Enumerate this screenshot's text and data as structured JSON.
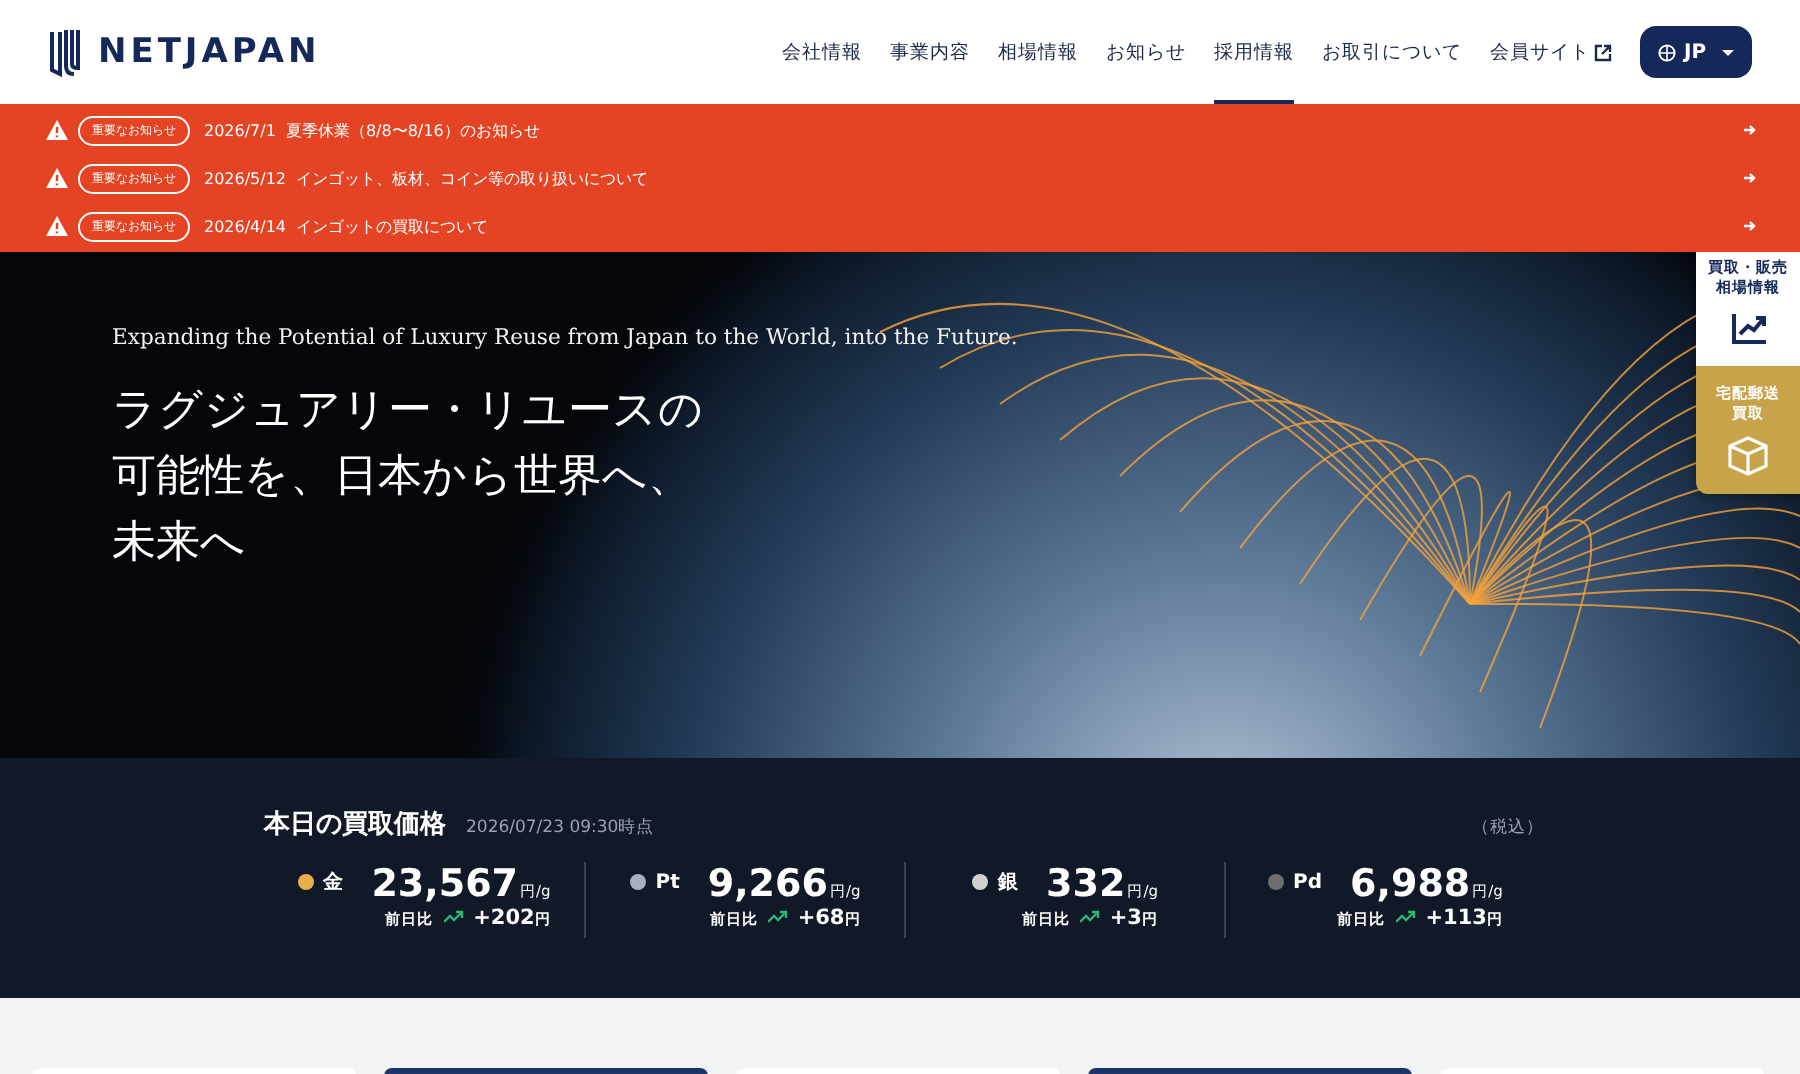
{
  "header": {
    "logo": "NETJAPAN",
    "nav": [
      {
        "label": "会社情報",
        "selected": false
      },
      {
        "label": "事業内容",
        "selected": false
      },
      {
        "label": "相場情報",
        "selected": false
      },
      {
        "label": "お知らせ",
        "selected": false
      },
      {
        "label": "採用情報",
        "selected": true
      },
      {
        "label": "お取引について",
        "selected": false
      },
      {
        "label": "会員サイト",
        "selected": false,
        "external": true
      }
    ],
    "language": "JP"
  },
  "notices": [
    {
      "badge": "重要なお知らせ",
      "date": "2026/7/1",
      "title": "夏季休業（8/8〜8/16）のお知らせ"
    },
    {
      "badge": "重要なお知らせ",
      "date": "2026/5/12",
      "title": "インゴット、板材、コイン等の取り扱いについて"
    },
    {
      "badge": "重要なお知らせ",
      "date": "2026/4/14",
      "title": "インゴットの買取について"
    }
  ],
  "hero": {
    "tagline": "Expanding the Potential of Luxury Reuse from Japan to the World, into the Future.",
    "headline": [
      "ラグジュアリー・リユースの",
      "可能性を、日本から世界へ、",
      "未来へ"
    ]
  },
  "side_tabs": [
    {
      "lines": [
        "買取・販売",
        "相場情報"
      ],
      "kind": "chart"
    },
    {
      "lines": [
        "宅配郵送",
        "買取"
      ],
      "kind": "box"
    }
  ],
  "prices": {
    "title": "本日の買取価格",
    "timestamp": "2026/07/23 09:30時点",
    "tax_note": "（税込）",
    "metals": [
      {
        "name": "金",
        "color": "#e8b04a",
        "price": "23,567",
        "unit": "円/g",
        "change_label": "前日比",
        "change": "+202",
        "change_unit": "円"
      },
      {
        "name": "Pt",
        "color": "#a9b0bd",
        "price": "9,266",
        "unit": "円/g",
        "change_label": "前日比",
        "change": "+68",
        "change_unit": "円"
      },
      {
        "name": "銀",
        "color": "#d0d0d0",
        "price": "332",
        "unit": "円/g",
        "change_label": "前日比",
        "change": "+3",
        "change_unit": "円"
      },
      {
        "name": "Pd",
        "color": "#6e6e6e",
        "price": "6,988",
        "unit": "円/g",
        "change_label": "前日比",
        "change": "+113",
        "change_unit": "円"
      }
    ]
  }
}
